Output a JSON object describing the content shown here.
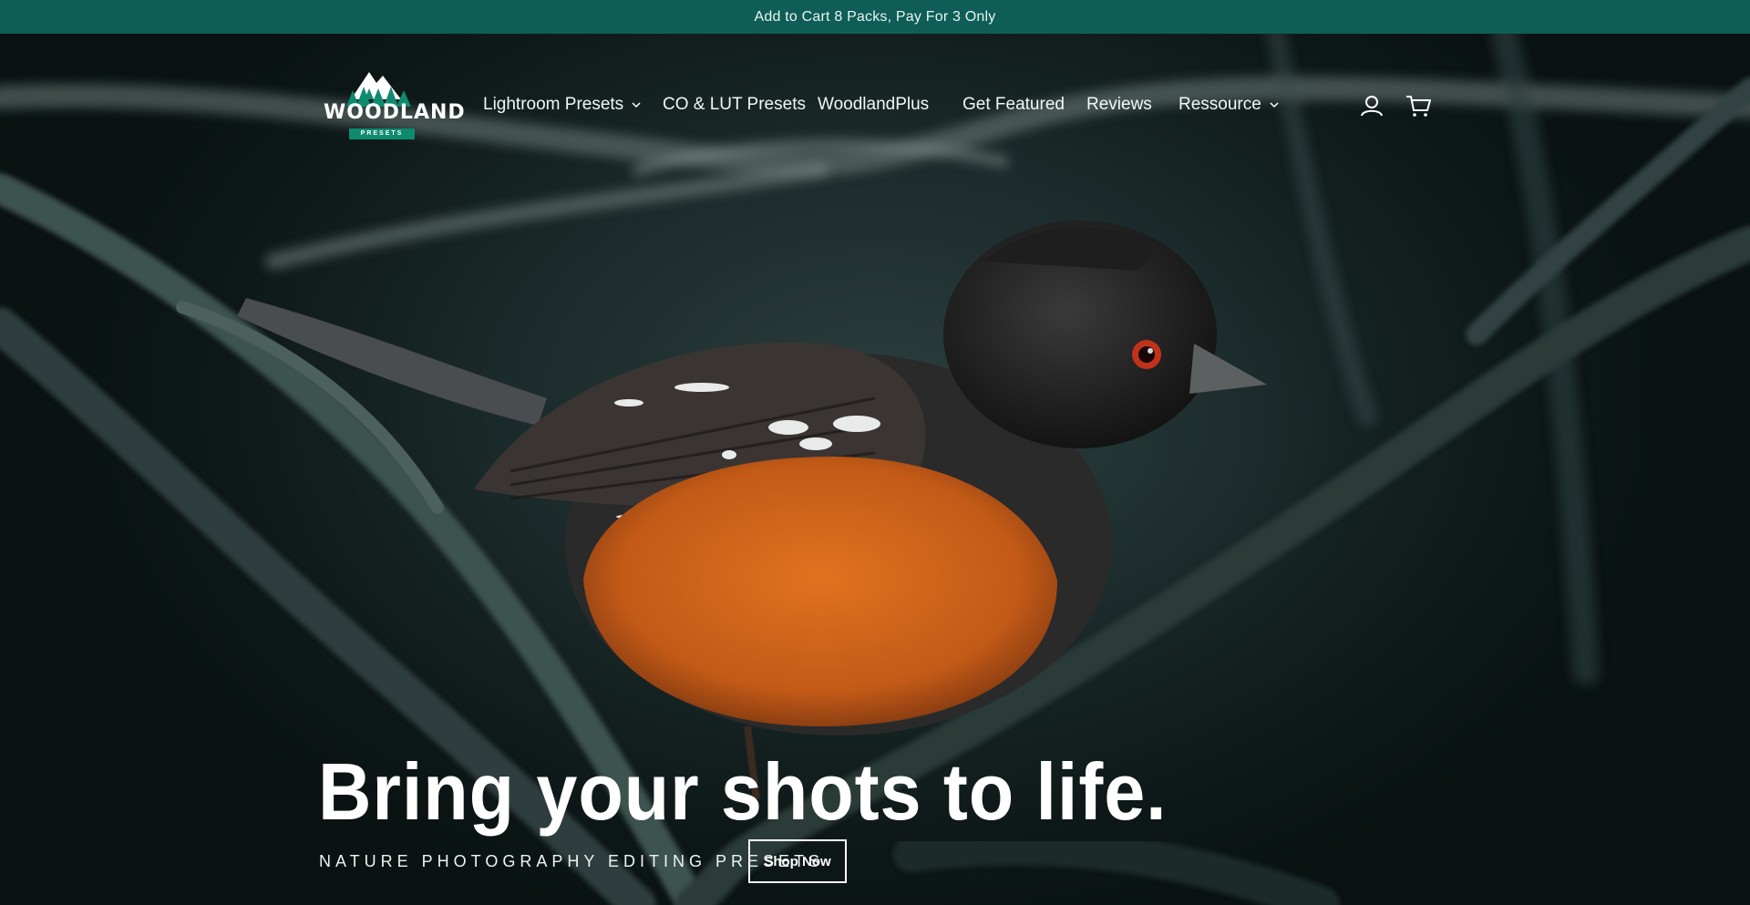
{
  "announcement": "Add to Cart 8 Packs, Pay For 3 Only",
  "logo": {
    "name": "WOODLAND",
    "sub": "PRESETS"
  },
  "nav": [
    {
      "label": "Lightroom Presets",
      "dropdown": true
    },
    {
      "label": "CO & LUT Presets",
      "dropdown": false
    },
    {
      "label": "WoodlandPlus",
      "dropdown": false
    },
    {
      "label": "Get Featured",
      "dropdown": false
    },
    {
      "label": "Reviews",
      "dropdown": false
    },
    {
      "label": "Ressource",
      "dropdown": true
    }
  ],
  "icons": {
    "account": "user-icon",
    "cart": "cart-icon"
  },
  "hero": {
    "title": "Bring your shots to life.",
    "subtitle": "NATURE PHOTOGRAPHY EDITING PRESETS",
    "cta": "Shop Now"
  },
  "colors": {
    "announcement_bg": "#0e5e57",
    "logo_green": "#0e8a6f",
    "breast_orange": "#d8661c"
  }
}
